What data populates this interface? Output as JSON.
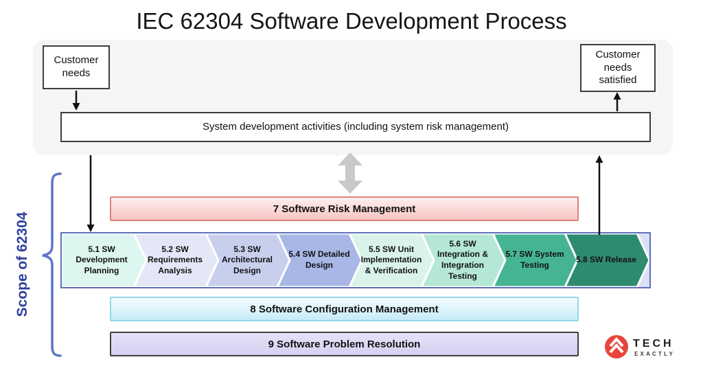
{
  "title": "IEC 62304 Software Development Process",
  "top_section": {
    "customer_needs": "Customer needs",
    "customer_needs_satisfied": "Customer needs satisfied",
    "system_activities": "System development activities (including system risk management)",
    "panel_color": "#f5f5f6",
    "double_arrow_color": "#c9c9c9"
  },
  "scope": {
    "label": "Scope of 62304",
    "text_color": "#2e3f9f",
    "bracket_color": "#5b75c9"
  },
  "risk_bar": {
    "label": "7 Software Risk Management",
    "fill": "#f9dbd9",
    "border": "#e0807a"
  },
  "process": {
    "container_fill": "#dce0f3",
    "container_border": "#5c6fba",
    "steps": [
      {
        "label": "5.1 SW Development Planning",
        "color": "#ddf6ef"
      },
      {
        "label": "5.2 SW Requirements Analysis",
        "color": "#e4e7f7"
      },
      {
        "label": "5.3 SW Architectural Design",
        "color": "#c7cfed"
      },
      {
        "label": "5.4 SW Detailed Design",
        "color": "#a9b7e6"
      },
      {
        "label": "5.5 SW Unit Implementation & Verification",
        "color": "#d9f3e9"
      },
      {
        "label": "5.6 SW Integration & Integration Testing",
        "color": "#b5e7d6"
      },
      {
        "label": "5.7 SW System Testing",
        "color": "#45b492"
      },
      {
        "label": "5.8 SW Release",
        "color": "#2e8b6f"
      }
    ]
  },
  "config_bar": {
    "label": "8 Software Configuration Management",
    "fill": "#ddf2fa",
    "border": "#90d8ec"
  },
  "problem_bar": {
    "label": "9 Software Problem Resolution",
    "fill": "#ddd8f5",
    "border": "#3f3f3f"
  },
  "logo": {
    "text": "TECH",
    "subtext": "EXACTLY",
    "icon_color": "#e8453c"
  }
}
